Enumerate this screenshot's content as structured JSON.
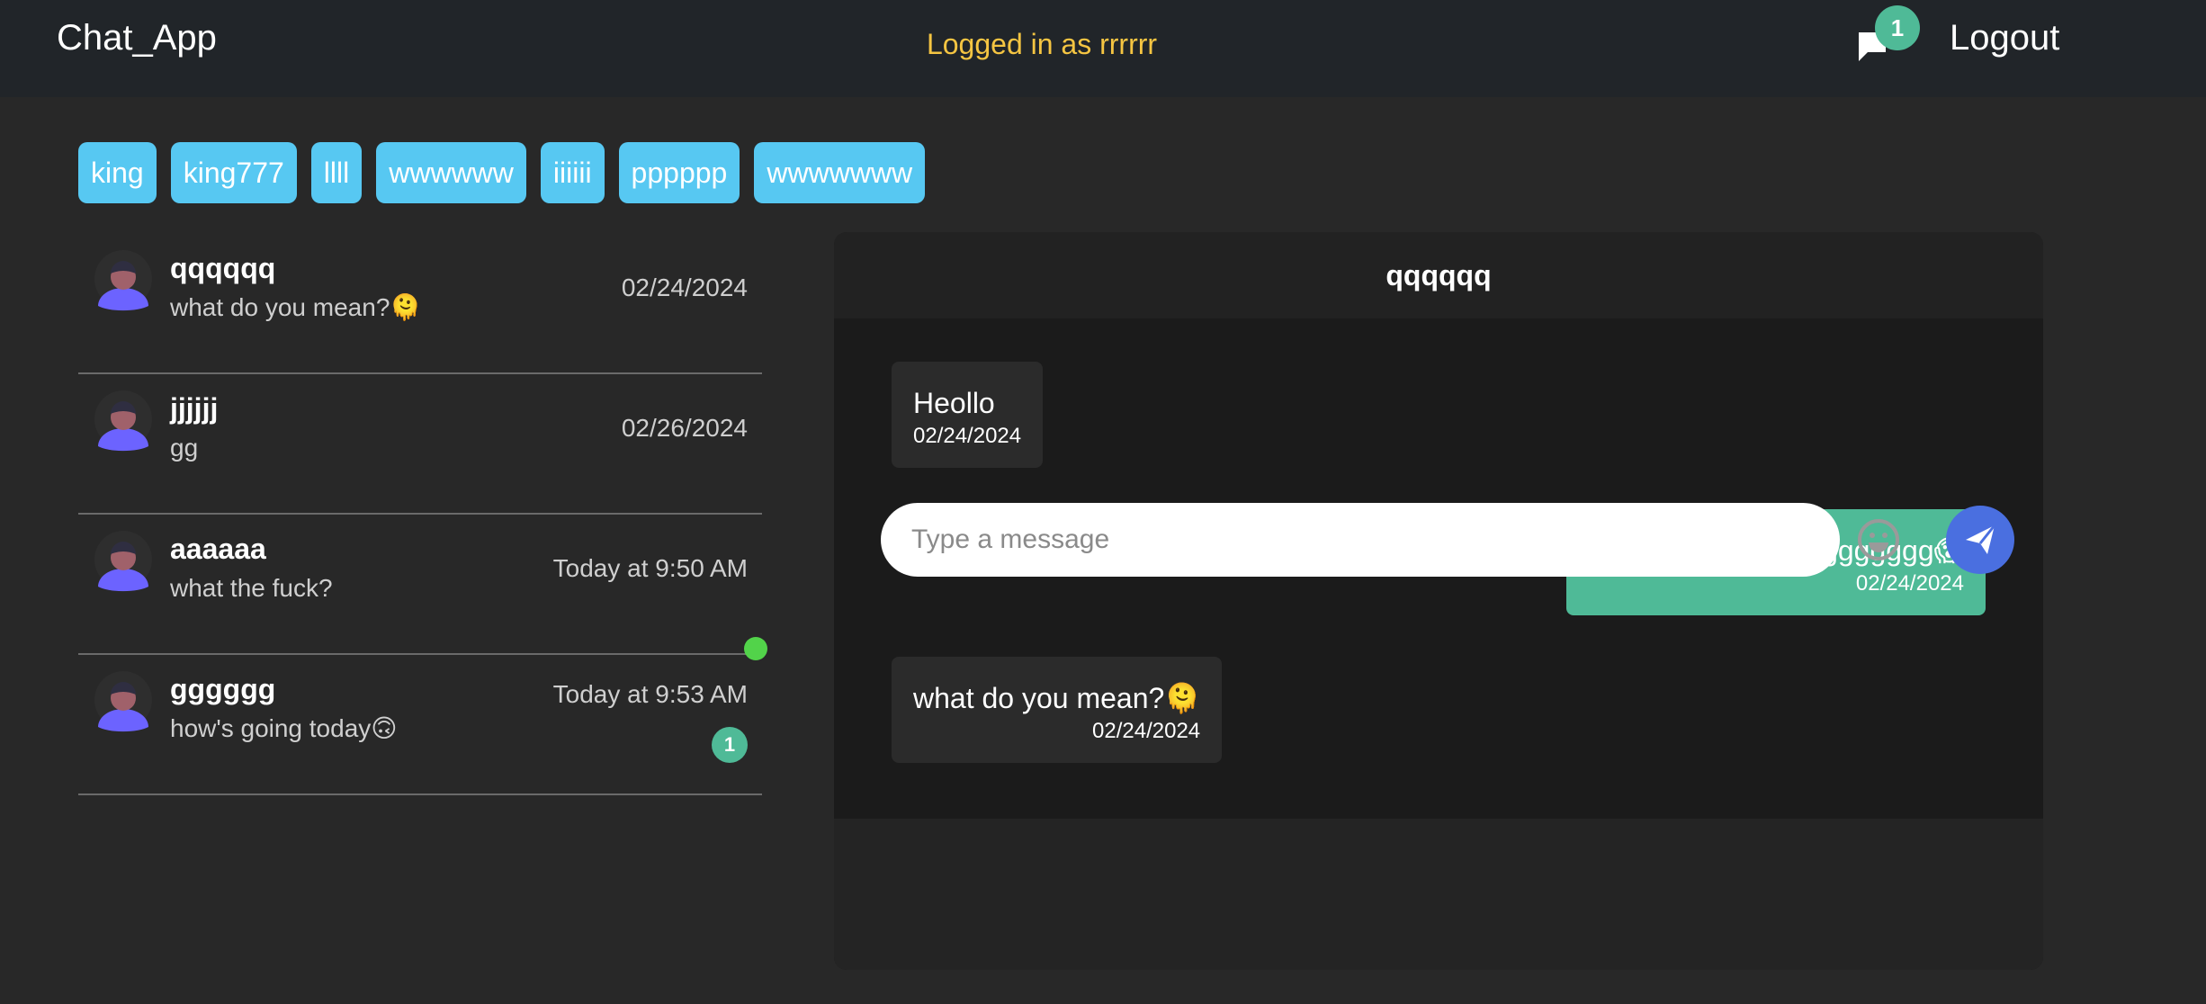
{
  "navbar": {
    "brand": "Chat_App",
    "logged_in_text": "Logged in as rrrrrr",
    "notification_count": "1",
    "logout_label": "Logout"
  },
  "users": [
    "king",
    "king777",
    "llll",
    "wwwwww",
    "iiiiii",
    "pppppp",
    "wwwwwww"
  ],
  "conversations": [
    {
      "name": "qqqqqq",
      "last_message": "what do you mean?🫠",
      "time": "02/24/2024",
      "online": false,
      "unread": ""
    },
    {
      "name": "jjjjjj",
      "last_message": "gg",
      "time": "02/26/2024",
      "online": false,
      "unread": ""
    },
    {
      "name": "aaaaaa",
      "last_message": "what the fuck?",
      "time": "Today at 9:50 AM",
      "online": false,
      "unread": ""
    },
    {
      "name": "gggggg",
      "last_message": "how's going today🙃",
      "time": "Today at 9:53 AM",
      "online": true,
      "unread": "1"
    }
  ],
  "chat": {
    "title": "qqqqqq",
    "messages": [
      {
        "direction": "in",
        "text": "Heollo",
        "time": "02/24/2024"
      },
      {
        "direction": "out",
        "text": "What are you doinggggggg😱",
        "time": "02/24/2024"
      },
      {
        "direction": "in",
        "text": "what do you mean?🫠",
        "time": "02/24/2024"
      }
    ],
    "input_placeholder": "Type a message"
  },
  "colors": {
    "background": "#282828",
    "navbar": "#212529",
    "chip": "#57c8f2",
    "accent_green": "#4fba97",
    "online_dot": "#52d34a",
    "send_button": "#4a6fe0",
    "logged_in_text": "#f5c542"
  },
  "icons": {
    "notification": "chat-bubble-icon",
    "avatar": "user-avatar-icon",
    "emoji": "smiley-face-icon",
    "send": "paper-plane-icon"
  }
}
